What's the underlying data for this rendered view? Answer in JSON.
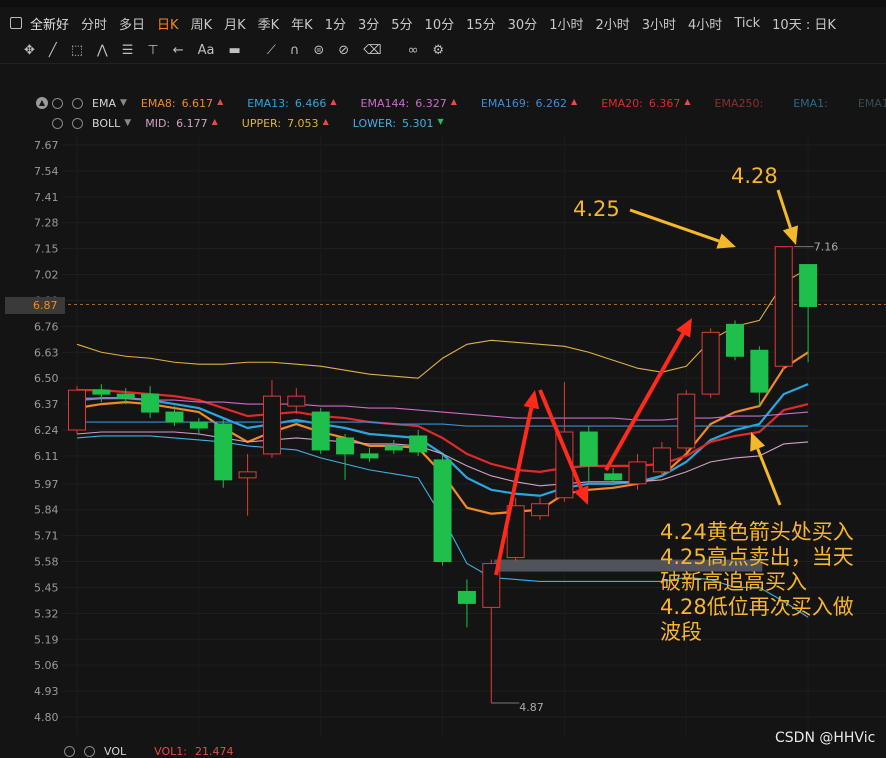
{
  "periods": [
    "全新好",
    "分时",
    "多日",
    "日K",
    "周K",
    "月K",
    "季K",
    "年K",
    "1分",
    "3分",
    "5分",
    "10分",
    "15分",
    "30分",
    "1小时",
    "2小时",
    "3小时",
    "4小时",
    "Tick",
    "10天 : 日K"
  ],
  "active_period": "日K",
  "toolbar_icons": [
    "crosshair-icon",
    "line-tool-icon",
    "rect-tool-icon",
    "wave-tool-icon",
    "fib-tool-icon",
    "measure-tool-icon",
    "arrow-tool-icon",
    "text-tool-icon",
    "note-tool-icon",
    "ruler-icon",
    "magnet-icon",
    "layer-icon",
    "hide-icon",
    "delete-icon",
    "link-icon",
    "settings-icon"
  ],
  "indicators": {
    "ema": {
      "name": "EMA",
      "items": [
        {
          "label": "EMA8:",
          "value": "6.617",
          "color": "#f08a24",
          "trend": "up"
        },
        {
          "label": "EMA13:",
          "value": "6.466",
          "color": "#2aa6e0",
          "trend": "up"
        },
        {
          "label": "EMA144:",
          "value": "6.327",
          "color": "#c86cc8",
          "trend": "up"
        },
        {
          "label": "EMA169:",
          "value": "6.262",
          "color": "#3a8fd8",
          "trend": "up"
        },
        {
          "label": "EMA20:",
          "value": "6.367",
          "color": "#e02a2a",
          "trend": "up"
        },
        {
          "label": "EMA250:",
          "value": "",
          "color": "#8a3030",
          "trend": ""
        },
        {
          "label": "EMA1:",
          "value": "",
          "color": "#2a6a8a",
          "trend": ""
        },
        {
          "label": "EMA1:",
          "value": "",
          "color": "#3a4a50",
          "trend": ""
        }
      ]
    },
    "boll": {
      "name": "BOLL",
      "items": [
        {
          "label": "MID:",
          "value": "6.177",
          "color": "#d0a0c8",
          "trend": "up"
        },
        {
          "label": "UPPER:",
          "value": "7.053",
          "color": "#e0b040",
          "trend": "up"
        },
        {
          "label": "LOWER:",
          "value": "5.301",
          "color": "#40b0e0",
          "trend": "down"
        }
      ]
    }
  },
  "current_price": "6.87",
  "volume": {
    "name": "VOL",
    "label": "VOL1:",
    "value": "21.474"
  },
  "annotations": {
    "label1": "4.25",
    "label2": "4.28",
    "note_lines": [
      "4.24黄色箭头处买入",
      "4.25高点卖出，当天",
      "破新高追高买入",
      "4.28低位再次买入做",
      "波段"
    ]
  },
  "watermark": "CSDN @HHVic",
  "chart_data": {
    "type": "candlestick",
    "y_ticks": [
      "7.67",
      "7.54",
      "7.41",
      "7.28",
      "7.15",
      "7.02",
      "6.89",
      "6.76",
      "6.63",
      "6.50",
      "6.37",
      "6.24",
      "6.11",
      "5.97",
      "5.84",
      "5.71",
      "5.58",
      "5.45",
      "5.32",
      "5.19",
      "5.06",
      "4.93",
      "4.80"
    ],
    "ylim": [
      4.8,
      7.67
    ],
    "max_label": "7.16",
    "min_label": "4.87",
    "candles": [
      {
        "o": 6.24,
        "c": 6.44,
        "h": 6.46,
        "l": 6.22
      },
      {
        "o": 6.44,
        "c": 6.42,
        "h": 6.47,
        "l": 6.38
      },
      {
        "o": 6.42,
        "c": 6.4,
        "h": 6.45,
        "l": 6.37
      },
      {
        "o": 6.42,
        "c": 6.33,
        "h": 6.46,
        "l": 6.3
      },
      {
        "o": 6.33,
        "c": 6.28,
        "h": 6.36,
        "l": 6.26
      },
      {
        "o": 6.28,
        "c": 6.25,
        "h": 6.3,
        "l": 6.22
      },
      {
        "o": 6.27,
        "c": 5.99,
        "h": 6.3,
        "l": 5.95
      },
      {
        "o": 6.0,
        "c": 6.03,
        "h": 6.12,
        "l": 5.81
      },
      {
        "o": 6.12,
        "c": 6.41,
        "h": 6.49,
        "l": 6.1
      },
      {
        "o": 6.36,
        "c": 6.41,
        "h": 6.45,
        "l": 6.32
      },
      {
        "o": 6.33,
        "c": 6.14,
        "h": 6.35,
        "l": 6.12
      },
      {
        "o": 6.2,
        "c": 6.12,
        "h": 6.22,
        "l": 5.99
      },
      {
        "o": 6.12,
        "c": 6.1,
        "h": 6.15,
        "l": 6.08
      },
      {
        "o": 6.16,
        "c": 6.14,
        "h": 6.19,
        "l": 6.12
      },
      {
        "o": 6.21,
        "c": 6.13,
        "h": 6.24,
        "l": 6.11
      },
      {
        "o": 6.09,
        "c": 5.58,
        "h": 6.12,
        "l": 5.56
      },
      {
        "o": 5.43,
        "c": 5.37,
        "h": 5.49,
        "l": 5.25
      },
      {
        "o": 5.35,
        "c": 5.57,
        "h": 5.59,
        "l": 4.87
      },
      {
        "o": 5.6,
        "c": 5.86,
        "h": 5.9,
        "l": 5.58
      },
      {
        "o": 5.81,
        "c": 5.87,
        "h": 5.9,
        "l": 5.79
      },
      {
        "o": 5.9,
        "c": 6.23,
        "h": 6.48,
        "l": 5.88
      },
      {
        "o": 6.23,
        "c": 6.06,
        "h": 6.26,
        "l": 5.98
      },
      {
        "o": 6.02,
        "c": 5.99,
        "h": 6.05,
        "l": 5.97
      },
      {
        "o": 5.97,
        "c": 6.08,
        "h": 6.12,
        "l": 5.94
      },
      {
        "o": 6.03,
        "c": 6.15,
        "h": 6.18,
        "l": 6.01
      },
      {
        "o": 6.15,
        "c": 6.42,
        "h": 6.44,
        "l": 6.13
      },
      {
        "o": 6.42,
        "c": 6.73,
        "h": 6.75,
        "l": 6.4
      },
      {
        "o": 6.77,
        "c": 6.61,
        "h": 6.79,
        "l": 6.59
      },
      {
        "o": 6.64,
        "c": 6.43,
        "h": 6.66,
        "l": 6.36
      },
      {
        "o": 6.56,
        "c": 7.16,
        "h": 7.16,
        "l": 6.54
      },
      {
        "o": 7.07,
        "c": 6.86,
        "h": 7.07,
        "l": 6.58
      }
    ],
    "series": [
      {
        "name": "EMA8",
        "color": "#f08a24",
        "values": [
          6.35,
          6.37,
          6.38,
          6.37,
          6.35,
          6.33,
          6.25,
          6.18,
          6.23,
          6.27,
          6.23,
          6.2,
          6.16,
          6.16,
          6.15,
          6.02,
          5.85,
          5.82,
          5.83,
          5.84,
          5.92,
          5.94,
          5.95,
          5.97,
          6.01,
          6.12,
          6.27,
          6.33,
          6.36,
          6.55,
          6.63
        ]
      },
      {
        "name": "EMA13",
        "color": "#2aa6e0",
        "values": [
          6.39,
          6.4,
          6.4,
          6.39,
          6.37,
          6.35,
          6.3,
          6.25,
          6.27,
          6.29,
          6.27,
          6.25,
          6.22,
          6.21,
          6.2,
          6.12,
          6.0,
          5.94,
          5.92,
          5.91,
          5.95,
          5.97,
          5.97,
          5.98,
          6.01,
          6.08,
          6.19,
          6.24,
          6.27,
          6.42,
          6.47
        ]
      },
      {
        "name": "EMA20",
        "color": "#e02a2a",
        "values": [
          6.44,
          6.44,
          6.43,
          6.42,
          6.41,
          6.39,
          6.35,
          6.31,
          6.32,
          6.33,
          6.31,
          6.3,
          6.28,
          6.27,
          6.26,
          6.2,
          6.12,
          6.07,
          6.04,
          6.03,
          6.05,
          6.06,
          6.06,
          6.06,
          6.07,
          6.11,
          6.18,
          6.21,
          6.23,
          6.34,
          6.37
        ]
      },
      {
        "name": "EMA144",
        "color": "#c86cc8",
        "values": [
          6.4,
          6.4,
          6.4,
          6.39,
          6.39,
          6.38,
          6.38,
          6.37,
          6.37,
          6.37,
          6.36,
          6.36,
          6.35,
          6.35,
          6.34,
          6.33,
          6.32,
          6.31,
          6.3,
          6.3,
          6.3,
          6.3,
          6.3,
          6.29,
          6.29,
          6.3,
          6.3,
          6.31,
          6.31,
          6.32,
          6.33
        ]
      },
      {
        "name": "EMA169",
        "color": "#3a8fd8",
        "values": [
          6.28,
          6.28,
          6.28,
          6.28,
          6.28,
          6.28,
          6.28,
          6.28,
          6.28,
          6.28,
          6.28,
          6.28,
          6.28,
          6.27,
          6.27,
          6.27,
          6.26,
          6.26,
          6.26,
          6.26,
          6.26,
          6.26,
          6.26,
          6.26,
          6.26,
          6.26,
          6.26,
          6.26,
          6.26,
          6.26,
          6.26
        ]
      },
      {
        "name": "MID",
        "color": "#d0a0c8",
        "values": [
          6.22,
          6.23,
          6.23,
          6.23,
          6.23,
          6.22,
          6.2,
          6.18,
          6.19,
          6.2,
          6.19,
          6.18,
          6.17,
          6.17,
          6.16,
          6.12,
          6.06,
          6.01,
          5.98,
          5.96,
          5.97,
          5.98,
          5.98,
          5.98,
          5.99,
          6.03,
          6.08,
          6.1,
          6.11,
          6.17,
          6.18
        ]
      },
      {
        "name": "UPPER",
        "color": "#e0b040",
        "values": [
          6.67,
          6.63,
          6.61,
          6.6,
          6.58,
          6.57,
          6.57,
          6.58,
          6.58,
          6.57,
          6.56,
          6.54,
          6.52,
          6.51,
          6.5,
          6.6,
          6.67,
          6.69,
          6.68,
          6.67,
          6.66,
          6.63,
          6.59,
          6.55,
          6.53,
          6.56,
          6.69,
          6.76,
          6.79,
          6.98,
          7.05
        ]
      },
      {
        "name": "LOWER",
        "color": "#40b0e0",
        "values": [
          6.2,
          6.21,
          6.21,
          6.21,
          6.2,
          6.19,
          6.18,
          6.16,
          6.15,
          6.14,
          6.1,
          6.07,
          6.04,
          6.02,
          6.0,
          5.8,
          5.57,
          5.5,
          5.49,
          5.48,
          5.48,
          5.48,
          5.48,
          5.48,
          5.48,
          5.5,
          5.49,
          5.45,
          5.45,
          5.38,
          5.3
        ]
      }
    ]
  }
}
